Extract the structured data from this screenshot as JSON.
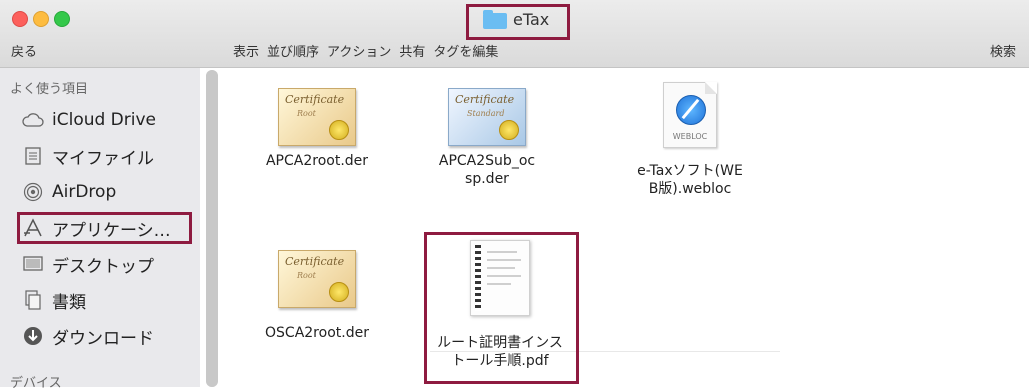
{
  "window": {
    "title": "eTax"
  },
  "toolbar": {
    "back_label": "戻る",
    "items": [
      "表示",
      "並び順序",
      "アクション",
      "共有",
      "タグを編集"
    ],
    "search_label": "検索"
  },
  "sidebar": {
    "favorites_header": "よく使う項目",
    "items": [
      {
        "label": "iCloud Drive",
        "icon": "cloud-icon"
      },
      {
        "label": "マイファイル",
        "icon": "document-icon"
      },
      {
        "label": "AirDrop",
        "icon": "airdrop-icon"
      },
      {
        "label": "アプリケーシ…",
        "icon": "applications-icon"
      },
      {
        "label": "デスクトップ",
        "icon": "desktop-icon"
      },
      {
        "label": "書類",
        "icon": "folder-documents-icon"
      },
      {
        "label": "ダウンロード",
        "icon": "download-icon"
      }
    ],
    "devices_header": "デバイス"
  },
  "files": [
    {
      "name": "APCA2root.der",
      "icon": "certificate-icon",
      "cert_title": "Certificate",
      "cert_sub": "Root"
    },
    {
      "name": "APCA2Sub_ocsp.der",
      "icon": "certificate-icon",
      "cert_title": "Certificate",
      "cert_sub": "Standard"
    },
    {
      "name": "e-Taxソフト(WEB版).webloc",
      "icon": "webloc-icon",
      "badge": "WEBLOC"
    },
    {
      "name": "OSCA2root.der",
      "icon": "certificate-icon",
      "cert_title": "Certificate",
      "cert_sub": "Root"
    },
    {
      "name": "ルート証明書インストール手順.pdf",
      "icon": "pdf-document-icon"
    }
  ]
}
